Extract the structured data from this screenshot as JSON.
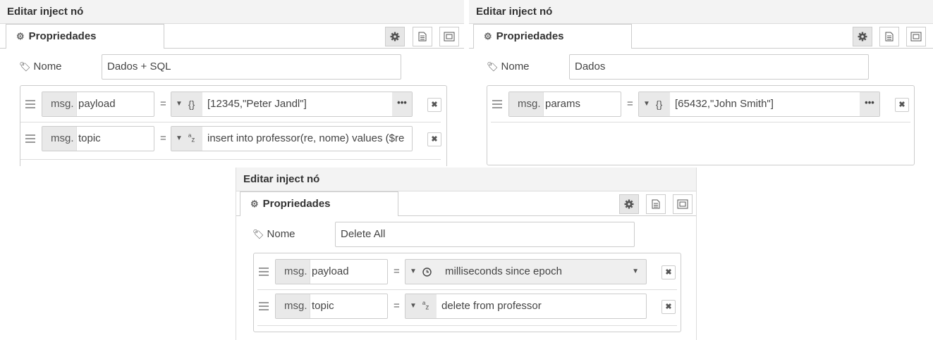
{
  "panels": [
    {
      "title": "Editar inject nó",
      "tab": "Propriedades",
      "name_label": "Nome",
      "name_value": "Dados + SQL",
      "props": [
        {
          "prefix": "msg.",
          "property": "payload",
          "eq": "=",
          "type_icon": "{}",
          "value": "[12345,\"Peter Jandl\"]"
        },
        {
          "prefix": "msg.",
          "property": "topic",
          "eq": "=",
          "type_icon": "az",
          "value": "insert into professor(re, nome) values ($re"
        }
      ]
    },
    {
      "title": "Editar inject nó",
      "tab": "Propriedades",
      "name_label": "Nome",
      "name_value": "Dados",
      "props": [
        {
          "prefix": "msg.",
          "property": "params",
          "eq": "=",
          "type_icon": "{}",
          "value": "[65432,\"John Smith\"]"
        }
      ]
    },
    {
      "title": "Editar inject nó",
      "tab": "Propriedades",
      "name_label": "Nome",
      "name_value": "Delete All",
      "props": [
        {
          "prefix": "msg.",
          "property": "payload",
          "eq": "=",
          "type_icon": "clock",
          "value": "milliseconds since epoch"
        },
        {
          "prefix": "msg.",
          "property": "topic",
          "eq": "=",
          "type_icon": "az",
          "value": "delete from professor"
        }
      ]
    }
  ],
  "icons": {
    "gear": "gear-icon",
    "info": "info-icon",
    "frame": "appearance-icon",
    "tag": "tag-icon",
    "remove": "remove-icon",
    "drag": "drag-handle-icon",
    "json": "json-type-icon",
    "string": "string-type-icon",
    "timestamp": "clock-icon"
  },
  "colors": {
    "header_bg": "#f3f3f3",
    "field_gray": "#e9e9e9",
    "border": "#cccccc"
  }
}
